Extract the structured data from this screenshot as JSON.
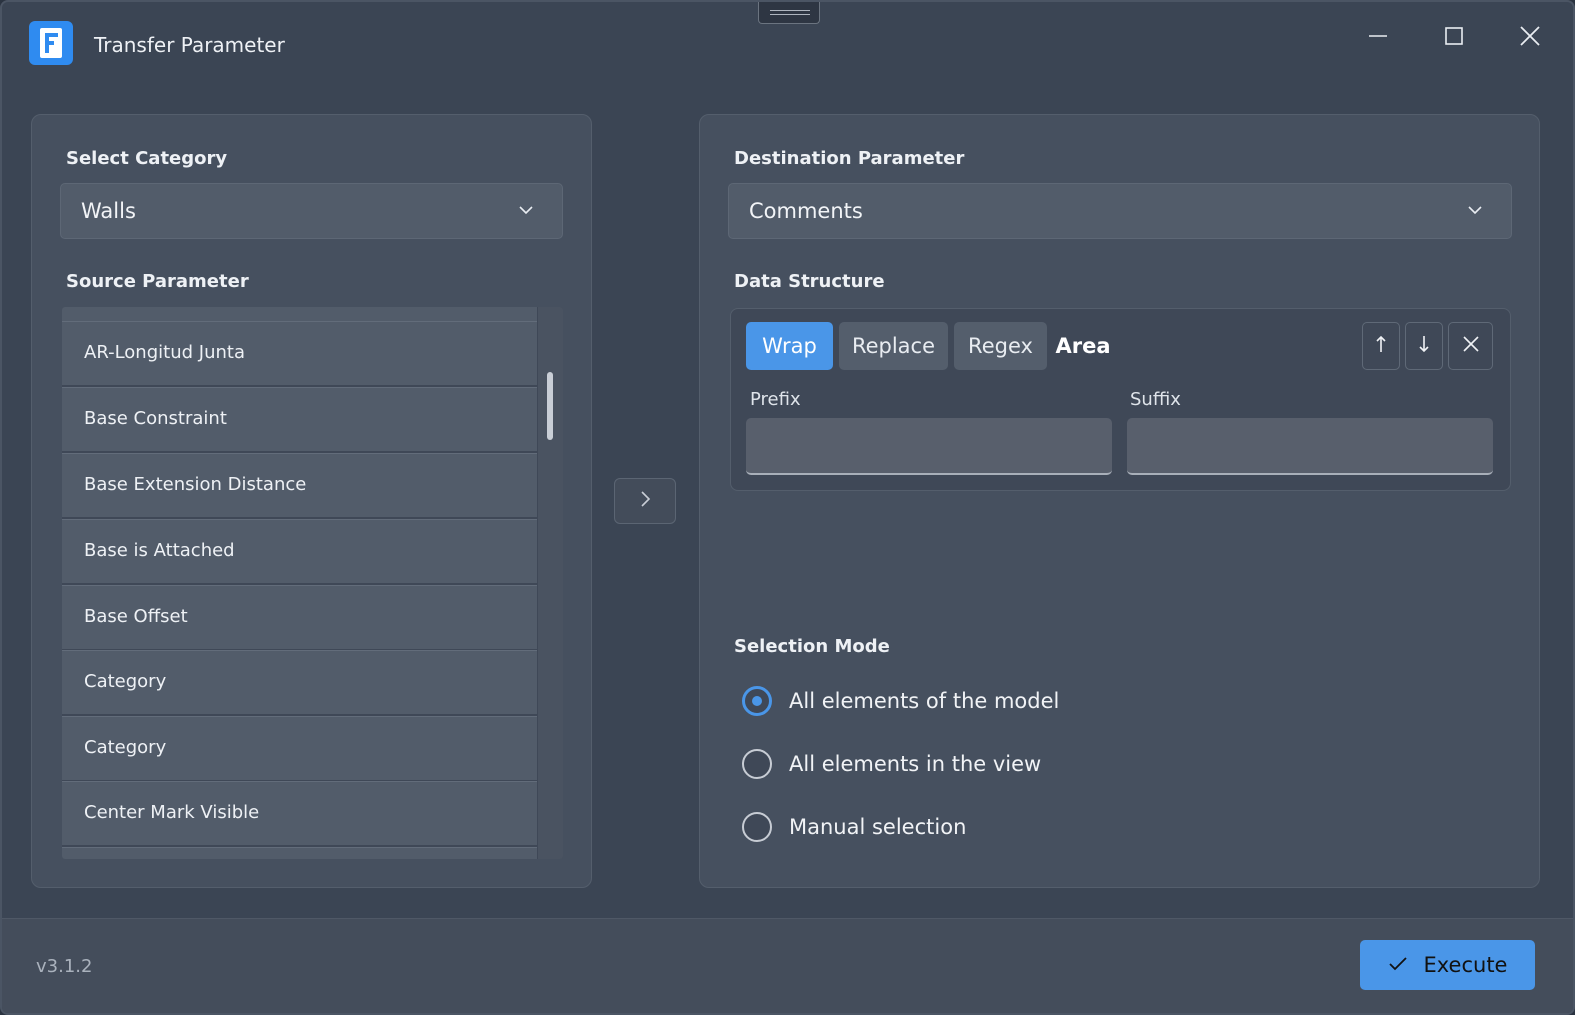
{
  "window": {
    "title": "Transfer Parameter",
    "app_icon": "app-logo-icon"
  },
  "left": {
    "category_label": "Select Category",
    "category_value": "Walls",
    "source_label": "Source Parameter",
    "source_items": [
      {
        "label": "AR-Longitud Junta"
      },
      {
        "label": "Base Constraint"
      },
      {
        "label": "Base Extension Distance"
      },
      {
        "label": "Base is Attached"
      },
      {
        "label": "Base Offset"
      },
      {
        "label": "Category"
      },
      {
        "label": "Category"
      },
      {
        "label": "Center Mark Visible"
      }
    ]
  },
  "right": {
    "destination_label": "Destination Parameter",
    "destination_value": "Comments",
    "structure_label": "Data Structure",
    "tabs": {
      "wrap": "Wrap",
      "replace": "Replace",
      "regex": "Regex",
      "area": "Area"
    },
    "prefix_label": "Prefix",
    "suffix_label": "Suffix",
    "prefix_value": "",
    "suffix_value": "",
    "selection_label": "Selection Mode",
    "selection_options": [
      {
        "label": "All elements of the model",
        "checked": true
      },
      {
        "label": "All elements in the view",
        "checked": false
      },
      {
        "label": "Manual selection",
        "checked": false
      }
    ]
  },
  "footer": {
    "version": "v3.1.2",
    "execute_label": "Execute"
  },
  "colors": {
    "accent": "#4a96e8",
    "background": "#3b4554",
    "panel": "#46505f"
  }
}
